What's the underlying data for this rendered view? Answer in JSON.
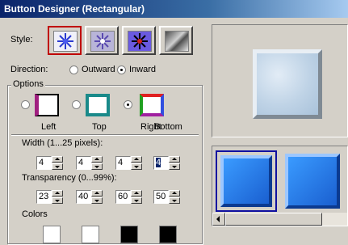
{
  "window": {
    "title": "Button Designer (Rectangular)"
  },
  "style": {
    "label": "Style:",
    "buttons": [
      {
        "icon": "blue-star-icon",
        "selected": true
      },
      {
        "icon": "purple-star-icon",
        "selected": false
      },
      {
        "icon": "black-star-icon",
        "selected": false
      },
      {
        "icon": "textured-stone-icon",
        "selected": false
      }
    ]
  },
  "direction": {
    "label": "Direction:",
    "options": [
      {
        "label": "Outward",
        "selected": false
      },
      {
        "label": "Inward",
        "selected": true
      }
    ]
  },
  "options": {
    "group_label": "Options",
    "light_directions": [
      {
        "label": "Left",
        "selected": false
      },
      {
        "label": "Top",
        "selected": false
      },
      {
        "label": "Right",
        "selected": true
      },
      {
        "label": "Bottom",
        "selected": false
      }
    ],
    "width_label": "Width (1...25 pixels):",
    "width_values": [
      "4",
      "4",
      "4",
      "4"
    ],
    "transparency_label": "Transparency (0...99%):",
    "transparency_values": [
      "23",
      "40",
      "60",
      "50"
    ],
    "colors_label": "Colors",
    "colors": [
      "#ffffff",
      "#ffffff",
      "#000000",
      "#000000"
    ]
  }
}
